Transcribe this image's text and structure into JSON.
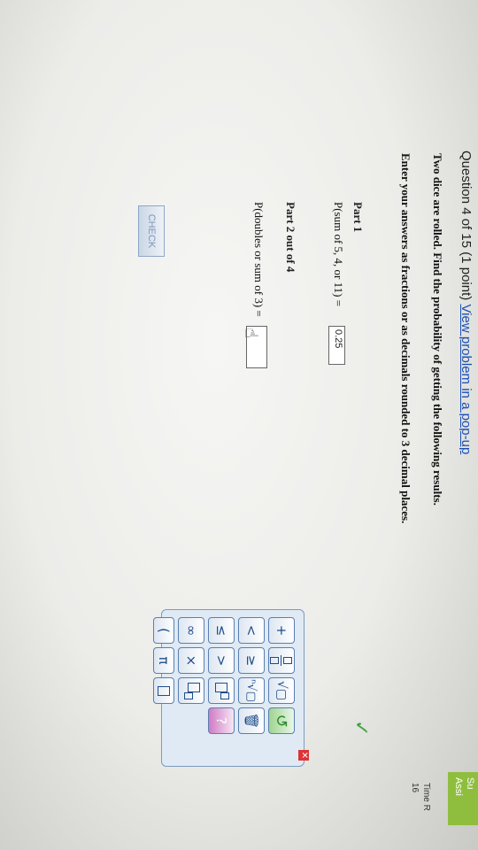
{
  "header": {
    "question_label": "Question 4 of 15 (1 point)",
    "popup_link": "View problem in a pop-up"
  },
  "problem": {
    "line1": "Two dice are rolled. Find the probability of getting the following results.",
    "line2": "Enter your answers as fractions or as decimals rounded to 3 decimal places."
  },
  "part1": {
    "title": "Part 1",
    "expression": "P(sum of 5, 4, or 11) =",
    "answer": "0.25"
  },
  "part2": {
    "title": "Part 2 out of 4",
    "expression": "P(doubles or sum of 3) =",
    "answer": ""
  },
  "check_button": "CHECK",
  "palette": {
    "close": "✕",
    "keys": [
      "+",
      "<",
      "≤",
      "∞",
      "(",
      "≥",
      ">",
      "×",
      "π",
      "?"
    ]
  },
  "status_check": "✓",
  "side": {
    "submit": [
      "Su",
      "Assi"
    ],
    "time": [
      "Time R",
      "16"
    ]
  }
}
